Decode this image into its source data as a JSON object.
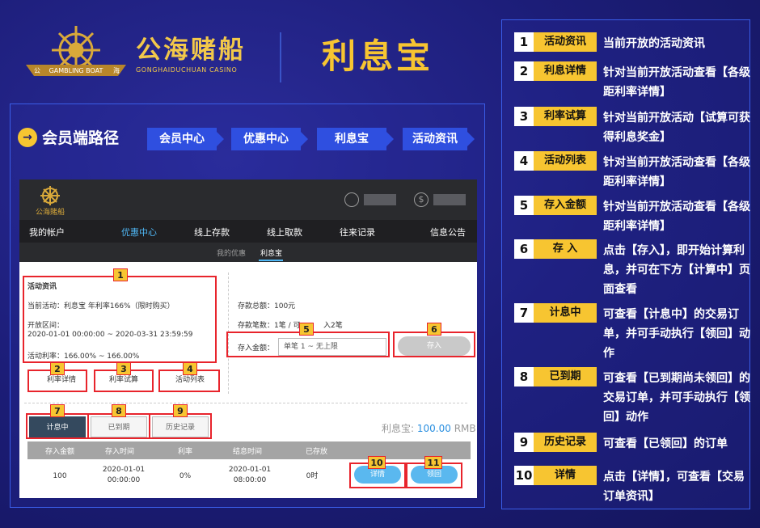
{
  "header": {
    "brand_cn": "公海赌船",
    "brand_en": "GONGHAIDUCHUAN CASINO",
    "logo_text": "GAMBLING BOAT",
    "logo_left": "公",
    "logo_right": "海",
    "title": "利息宝"
  },
  "path": {
    "icon": "→",
    "label": "会员端路径",
    "crumbs": [
      "会员中心",
      "优惠中心",
      "利息宝",
      "活动资讯"
    ]
  },
  "shot": {
    "logo_text": "公海賭船",
    "nav": [
      "我的帐户",
      "优惠中心",
      "线上存款",
      "线上取款",
      "往来记录",
      "信息公告"
    ],
    "subnav": [
      "我的优惠",
      "利息宝"
    ],
    "info": {
      "title": "活动资讯",
      "current": "当前活动：利息宝 年利率166%（限时购买）",
      "period_label": "开放区间：",
      "period": "2020-01-01 00:00:00 ~ 2020-03-31 23:59:59",
      "rate": "活动利率：166.00% ~ 166.00%"
    },
    "deposit_total": "存款总额：100元",
    "deposit_count_a": "存款笔数：1笔 / 可",
    "deposit_count_b": "入2笔",
    "deposit_amount_label": "存入金额：",
    "deposit_placeholder": "单笔 1 ~ 无上限",
    "deposit_button": "存入",
    "buttons": [
      "利率详情",
      "利率试算",
      "活动列表"
    ],
    "tabs": [
      "计息中",
      "已到期",
      "历史记录"
    ],
    "rate_label": "利息宝:",
    "rate_value": "100.00",
    "rate_unit": "RMB",
    "table_headers": [
      "存入金额",
      "存入时间",
      "利率",
      "结息时间",
      "已存放"
    ],
    "row": {
      "amount": "100",
      "time_date": "2020-01-01",
      "time_clock": "00:00:00",
      "rate": "0%",
      "settle_date": "2020-01-01",
      "settle_clock": "08:00:00",
      "stored": "0时",
      "detail": "详情",
      "claim": "领回"
    }
  },
  "callouts": [
    "1",
    "2",
    "3",
    "4",
    "5",
    "6",
    "7",
    "8",
    "9",
    "10",
    "11"
  ],
  "legend": [
    {
      "num": "1",
      "tag": "活动资讯",
      "desc": "当前开放的活动资讯"
    },
    {
      "num": "2",
      "tag": "利息详情",
      "desc": "针对当前开放活动查看【各级距利率详情】"
    },
    {
      "num": "3",
      "tag": "利率试算",
      "desc": "针对当前开放活动【试算可获得利息奖金】"
    },
    {
      "num": "4",
      "tag": "活动列表",
      "desc": "针对当前开放活动查看【各级距利率详情】"
    },
    {
      "num": "5",
      "tag": "存入金额",
      "desc": "针对当前开放活动查看【各级距利率详情】"
    },
    {
      "num": "6",
      "tag": "存 入",
      "desc": "点击【存入】，即开始计算利息，并可在下方【计算中】页面查看"
    },
    {
      "num": "7",
      "tag": "计息中",
      "desc": "可查看【计息中】的交易订单，并可手动执行【领回】动作"
    },
    {
      "num": "8",
      "tag": "已到期",
      "desc": "可查看【已到期尚未领回】的交易订单，并可手动执行【领回】动作"
    },
    {
      "num": "9",
      "tag": "历史记录",
      "desc": "可查看【已领回】的订单"
    },
    {
      "num": "10",
      "tag": "详情",
      "desc": "点击【详情】，可查看【交易订单资讯】"
    }
  ],
  "colors": {
    "gold": "#f7c531",
    "blue": "#2f4fe0",
    "red": "#e8242c",
    "navy": "#1a1a6e"
  }
}
